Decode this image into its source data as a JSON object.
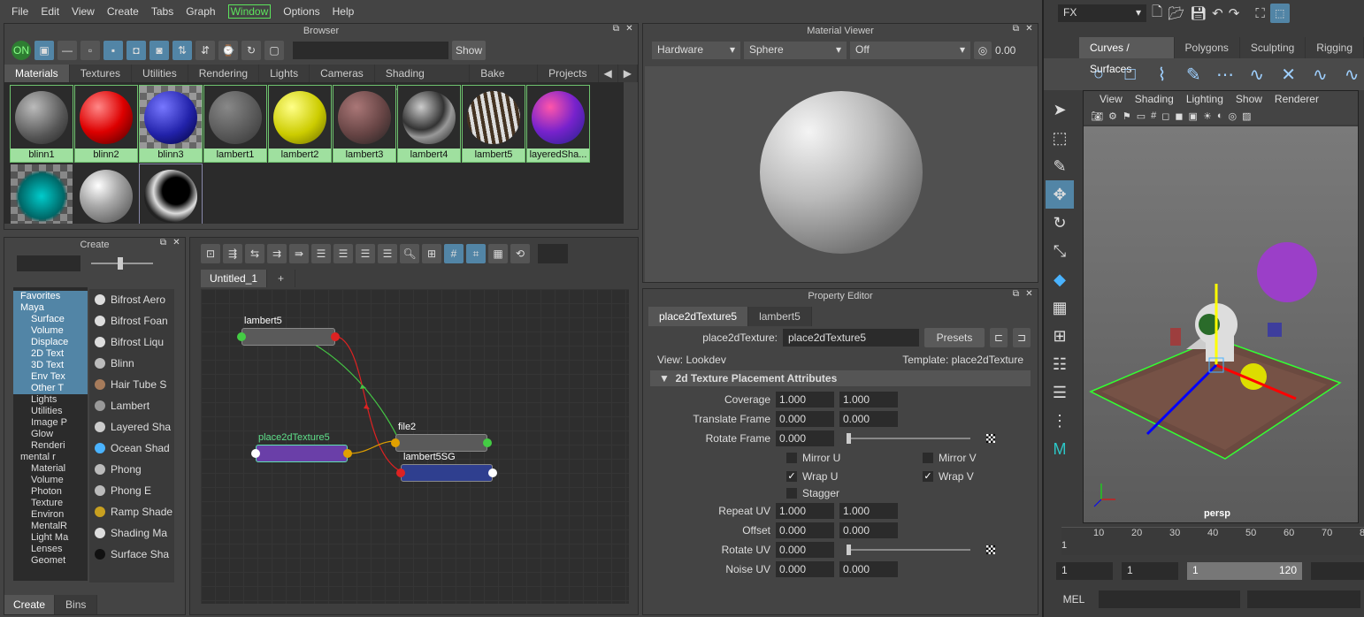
{
  "menubar": {
    "items": [
      "File",
      "Edit",
      "View",
      "Create",
      "Tabs",
      "Graph",
      "Window",
      "Options",
      "Help"
    ]
  },
  "browser": {
    "title": "Browser",
    "show_label": "Show",
    "tabs": [
      "Materials",
      "Textures",
      "Utilities",
      "Rendering",
      "Lights",
      "Cameras",
      "Shading Groups",
      "Bake Sets",
      "Projects"
    ],
    "swatches": [
      "blinn1",
      "blinn2",
      "blinn3",
      "lambert1",
      "lambert2",
      "lambert3",
      "lambert4",
      "lambert5",
      "layeredSha..."
    ]
  },
  "create_panel": {
    "title": "Create",
    "tree": [
      "Favorites",
      "Maya",
      "Surface",
      "Volume",
      "Displace",
      "2D Text",
      "3D Text",
      "Env Tex",
      "Other T",
      "Lights",
      "Utilities",
      "Image P",
      "Glow",
      "Renderi",
      "mental r",
      "Material",
      "Volume",
      "Photon",
      "Texture",
      "Environ",
      "MentalR",
      "Light Ma",
      "Lenses",
      "Geomet"
    ],
    "items": [
      "Bifrost Aero",
      "Bifrost Foan",
      "Bifrost Liqu",
      "Blinn",
      "Hair Tube S",
      "Lambert",
      "Layered Sha",
      "Ocean Shad",
      "Phong",
      "Phong E",
      "Ramp Shade",
      "Shading Ma",
      "Surface Sha"
    ],
    "bottom_tabs": [
      "Create",
      "Bins"
    ]
  },
  "node_editor": {
    "tab": "Untitled_1",
    "plus": "+",
    "nodes": {
      "lambert5": "lambert5",
      "place2d": "place2dTexture5",
      "file2": "file2",
      "sg": "lambert5SG"
    }
  },
  "material_viewer": {
    "title": "Material Viewer",
    "renderer": "Hardware",
    "shape": "Sphere",
    "env": "Off",
    "exposure": "0.00"
  },
  "property_editor": {
    "title": "Property Editor",
    "tabs": [
      "place2dTexture5",
      "lambert5"
    ],
    "node_label": "place2dTexture:",
    "node_value": "place2dTexture5",
    "presets": "Presets",
    "view_label": "View: Lookdev",
    "template_label": "Template: place2dTexture",
    "section": "2d Texture Placement Attributes",
    "coverage": {
      "label": "Coverage",
      "v1": "1.000",
      "v2": "1.000"
    },
    "translate": {
      "label": "Translate Frame",
      "v1": "0.000",
      "v2": "0.000"
    },
    "rotate_frame": {
      "label": "Rotate Frame",
      "v1": "0.000"
    },
    "mirror_u": "Mirror U",
    "mirror_v": "Mirror V",
    "wrap_u": "Wrap U",
    "wrap_v": "Wrap V",
    "stagger": "Stagger",
    "repeat": {
      "label": "Repeat UV",
      "v1": "1.000",
      "v2": "1.000"
    },
    "offset": {
      "label": "Offset",
      "v1": "0.000",
      "v2": "0.000"
    },
    "rotate_uv": {
      "label": "Rotate UV",
      "v1": "0.000"
    },
    "noise": {
      "label": "Noise UV",
      "v1": "0.000",
      "v2": "0.000"
    }
  },
  "right": {
    "mode": "FX",
    "shelf_tabs": [
      "Curves / Surfaces",
      "Polygons",
      "Sculpting",
      "Rigging"
    ],
    "viewport_menu": [
      "View",
      "Shading",
      "Lighting",
      "Show",
      "Renderer"
    ],
    "camera": "persp",
    "timeline": [
      "10",
      "20",
      "30",
      "40",
      "50",
      "60",
      "70",
      "8"
    ],
    "frame_start": "1",
    "range": [
      "1",
      "1",
      "1",
      "120"
    ],
    "mel": "MEL",
    "current_frame": "1"
  }
}
